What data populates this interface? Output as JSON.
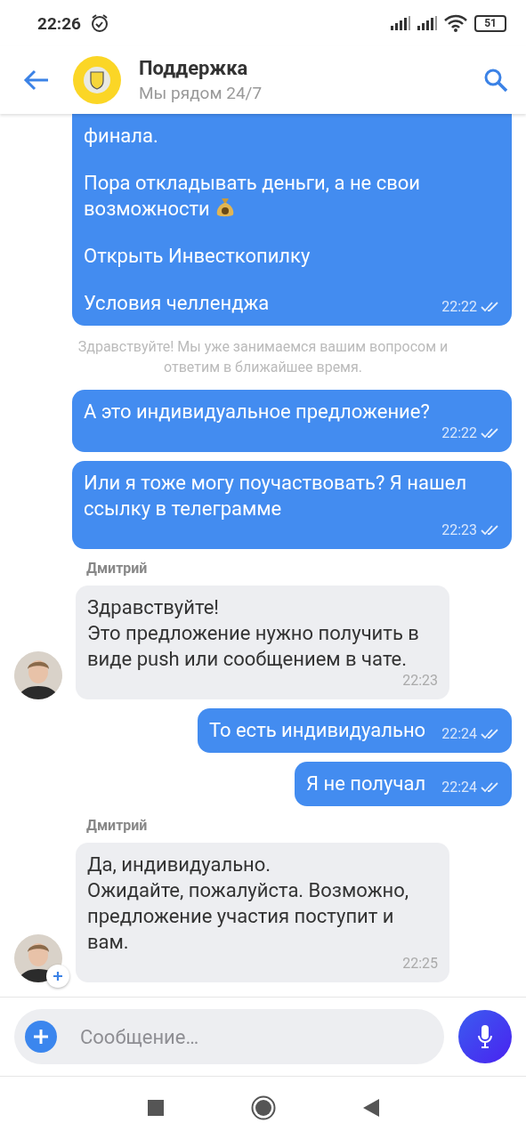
{
  "status_bar": {
    "time": "22:26",
    "battery": "51"
  },
  "header": {
    "title": "Поддержка",
    "subtitle": "Мы рядом 24/7"
  },
  "messages": [
    {
      "kind": "outgoing",
      "paragraphs": [
        "финала.",
        {
          "kind": "money",
          "text": "Пора откладывать деньги, а не свои возможности"
        },
        "Открыть Инвесткопилку",
        "Условия челленджа"
      ],
      "time": "22:22",
      "read": true
    },
    {
      "kind": "system",
      "text": "Здравствуйте! Мы уже занимаемся вашим вопросом и ответим в ближайшее время."
    },
    {
      "kind": "outgoing",
      "paragraphs": [
        "А это индивидуальное предложение?"
      ],
      "time": "22:22",
      "read": true
    },
    {
      "kind": "outgoing",
      "paragraphs": [
        "Или я тоже могу поучаствовать? Я нашел ссылку в телеграмме"
      ],
      "time": "22:23",
      "read": true
    },
    {
      "kind": "incoming",
      "sender": "Дмитрий",
      "paragraphs": [
        "Здравствуйте!\nЭто предложение нужно получить в виде push или сообщением в чате."
      ],
      "time": "22:23",
      "avatar_badge": false
    },
    {
      "kind": "outgoing",
      "paragraphs": [
        "То есть индивидуально"
      ],
      "time": "22:24",
      "read": true
    },
    {
      "kind": "outgoing",
      "paragraphs": [
        "Я не получал"
      ],
      "time": "22:24",
      "read": true
    },
    {
      "kind": "incoming",
      "sender": "Дмитрий",
      "paragraphs": [
        "Да, индивидуально.\nОжидайте, пожалуйста. Возможно, предложение участия поступит и вам."
      ],
      "time": "22:25",
      "avatar_badge": true
    }
  ],
  "composer": {
    "placeholder": "Сообщение…"
  }
}
